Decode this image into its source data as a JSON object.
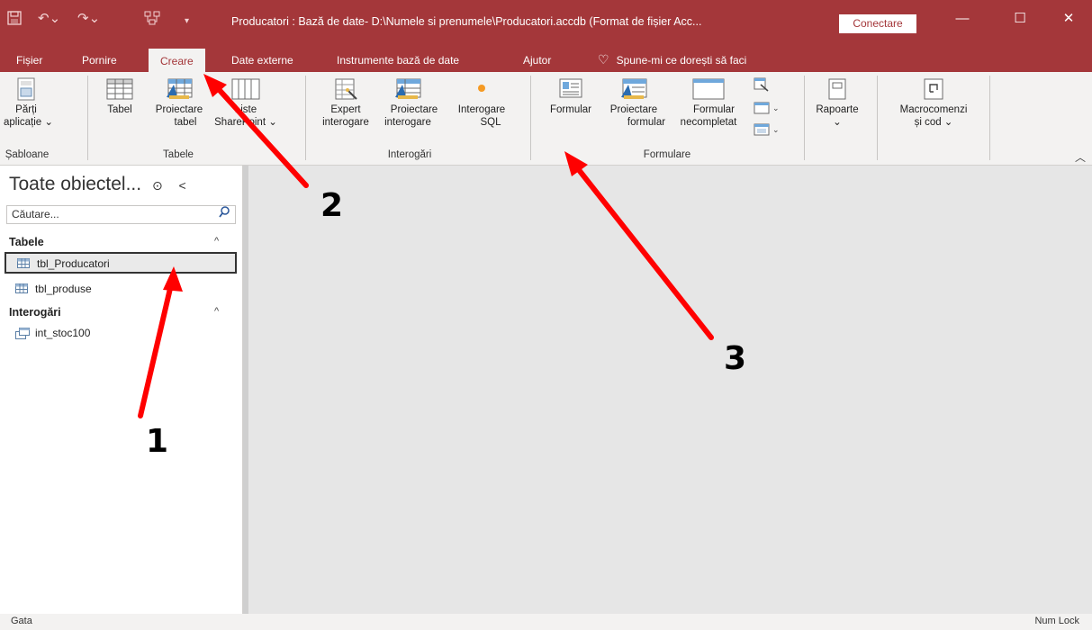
{
  "titlebar": {
    "title": "Producatori : Bază de date- D:\\Numele si prenumele\\Producatori.accdb (Format de fișier Acc...",
    "connect": "Conectare",
    "icons": [
      "save-icon",
      "undo-icon",
      "redo-icon",
      "relationships-icon",
      "customize-quick-access-icon"
    ],
    "window_controls": [
      "minimize-icon",
      "restore-icon",
      "close-icon"
    ],
    "accent_color": "#a4373a"
  },
  "menu": {
    "tabs": [
      "Fișier",
      "Pornire",
      "Creare",
      "Date externe",
      "Instrumente bază de date",
      "Ajutor"
    ],
    "active": "Creare",
    "tell_me": "Spune-mi ce dorești să faci"
  },
  "ribbon": {
    "groups": {
      "templates": {
        "label": "Șabloane",
        "parts": [
          "Părți",
          "aplicație ⌄"
        ]
      },
      "tables": {
        "label": "Tabele",
        "table": "Tabel",
        "design": [
          "Proiectare",
          "tabel"
        ],
        "sharepoint": [
          "Liste",
          "SharePoint ⌄"
        ]
      },
      "queries": {
        "label": "Interogări",
        "wizard": [
          "Expert",
          "interogare"
        ],
        "design": [
          "Proiectare",
          "interogare"
        ],
        "sql": [
          "Interogare",
          "SQL"
        ]
      },
      "forms": {
        "label": "Formulare",
        "form": "Formular",
        "design": [
          "Proiectare",
          "formular"
        ],
        "blank": [
          "Formular",
          "necompletat"
        ]
      },
      "reports": {
        "label": "Rapoarte",
        "caret": "⌄"
      },
      "macros": {
        "lines": [
          "Macrocomenzi",
          "și cod ⌄"
        ]
      }
    }
  },
  "nav": {
    "title": "Toate obiectel...",
    "search_placeholder": "Căutare...",
    "sections": [
      {
        "header": "Tabele",
        "items": [
          "tbl_Producatori",
          "tbl_produse"
        ]
      },
      {
        "header": "Interogări",
        "items": [
          "int_stoc100"
        ]
      }
    ]
  },
  "status": {
    "left": "Gata",
    "right": "Num Lock"
  },
  "annotations": {
    "labels": [
      "1",
      "2",
      "3"
    ],
    "arrow_color": "#ff0000"
  }
}
